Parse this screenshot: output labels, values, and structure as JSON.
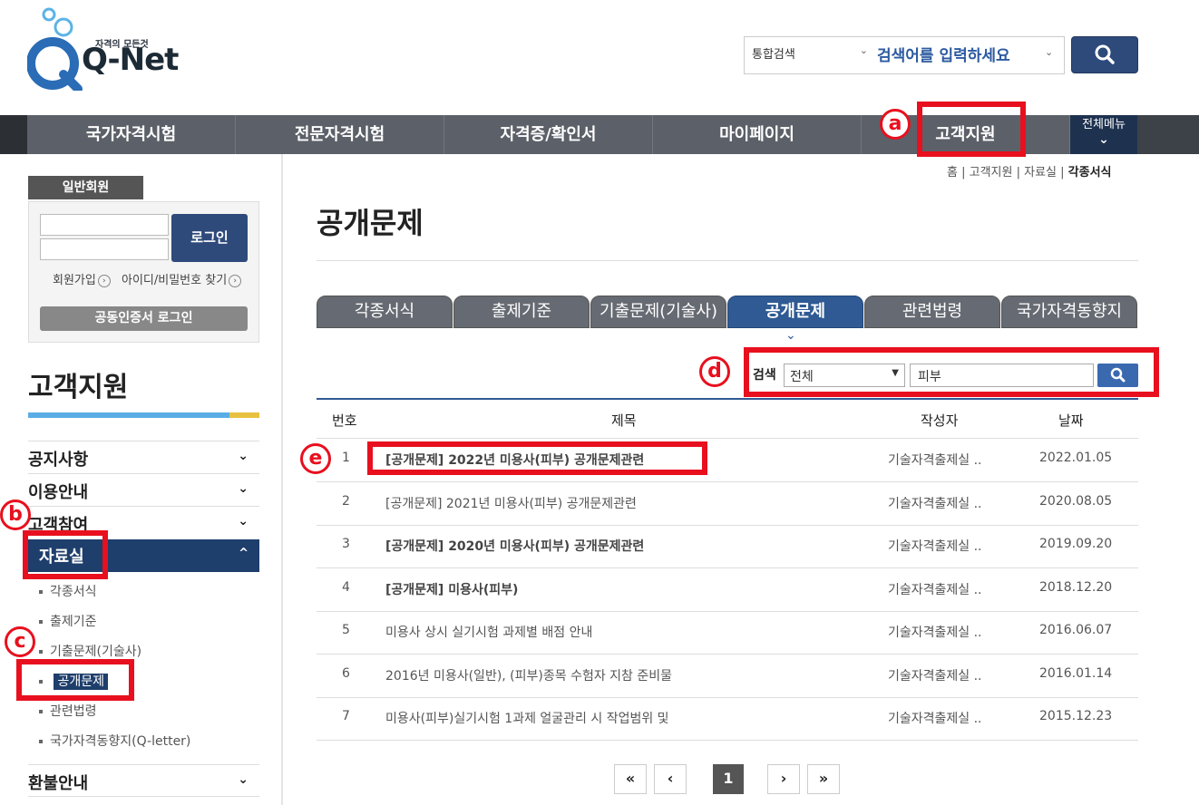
{
  "header": {
    "logo_tagline": "자격의 모든것",
    "logo_text": "Q-Net",
    "search_category": "통합검색",
    "search_placeholder": "검색어를 입력하세요"
  },
  "nav": {
    "items": [
      "국가자격시험",
      "전문자격시험",
      "자격증/확인서",
      "마이페이지",
      "고객지원"
    ],
    "all_menu": "전체메뉴"
  },
  "login": {
    "member_tab": "일반회원",
    "login_button": "로그인",
    "signup_link": "회원가입",
    "find_link": "아이디/비밀번호 찾기",
    "cert_button": "공동인증서 로그인"
  },
  "sidebar": {
    "title": "고객지원",
    "items": [
      "공지사항",
      "이용안내",
      "고객참여",
      "자료실"
    ],
    "sub_items": [
      "각종서식",
      "출제기준",
      "기출문제(기술사)",
      "공개문제",
      "관련법령",
      "국가자격동향지(Q-letter)"
    ],
    "last_item": "환불안내"
  },
  "breadcrumb": {
    "home": "홈",
    "level1": "고객지원",
    "level2": "자료실",
    "current": "각종서식"
  },
  "page": {
    "title": "공개문제"
  },
  "tabs": [
    "각종서식",
    "출제기준",
    "기출문제(기술사)",
    "공개문제",
    "관련법령",
    "국가자격동향지"
  ],
  "filter": {
    "label": "검색",
    "select_value": "전체",
    "input_value": "피부"
  },
  "table": {
    "headers": [
      "번호",
      "제목",
      "작성자",
      "날짜"
    ],
    "rows": [
      {
        "no": "1",
        "title": "[공개문제] 2022년 미용사(피부) 공개문제관련",
        "author": "기술자격출제실 ..",
        "date": "2022.01.05"
      },
      {
        "no": "2",
        "title": "[공개문제] 2021년 미용사(피부) 공개문제관련",
        "author": "기술자격출제실 ..",
        "date": "2020.08.05"
      },
      {
        "no": "3",
        "title": "[공개문제] 2020년 미용사(피부) 공개문제관련",
        "author": "기술자격출제실 ..",
        "date": "2019.09.20"
      },
      {
        "no": "4",
        "title": "[공개문제] 미용사(피부)",
        "author": "기술자격출제실 ..",
        "date": "2018.12.20"
      },
      {
        "no": "5",
        "title": "미용사 상시 실기시험 과제별 배점 안내",
        "author": "기술자격출제실 ..",
        "date": "2016.06.07"
      },
      {
        "no": "6",
        "title": "2016년 미용사(일반), (피부)종목 수험자 지참 준비물",
        "author": "기술자격출제실 ..",
        "date": "2016.01.14"
      },
      {
        "no": "7",
        "title": "미용사(피부)실기시험 1과제 얼굴관리 시 작업범위 및",
        "author": "기술자격출제실 ..",
        "date": "2015.12.23"
      }
    ]
  },
  "pagination": {
    "first": "«",
    "prev": "‹",
    "current": "1",
    "next": "›",
    "last": "»"
  },
  "annotations": {
    "a": "a",
    "b": "b",
    "c": "c",
    "d": "d",
    "e": "e"
  },
  "colors": {
    "annotation_red": "#e8101e",
    "brand_navy": "#1e3e6b",
    "tab_active": "#2f5a93"
  }
}
